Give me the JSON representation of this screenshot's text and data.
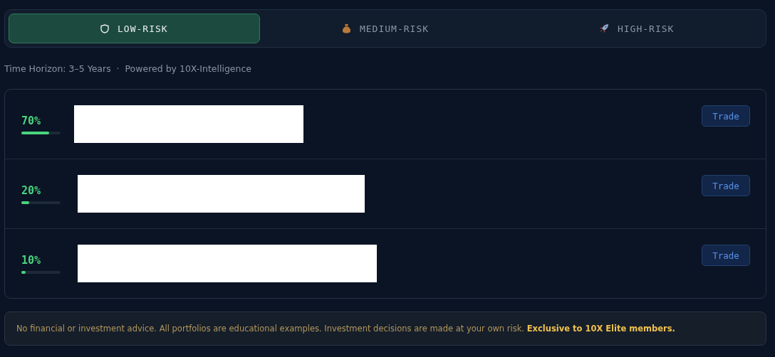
{
  "tabs": [
    {
      "label": "LOW-RISK",
      "kind": "shield",
      "selected": true
    },
    {
      "label": "MEDIUM-RISK",
      "kind": "bag",
      "selected": false
    },
    {
      "label": "HIGH-RISK",
      "kind": "rocket",
      "selected": false
    }
  ],
  "subtitle": "Time Horizon: 3–5 Years  ·  Powered by 10X-Intelligence",
  "allocations": [
    {
      "percent": "70%",
      "level": 0.7,
      "button": "Trade"
    },
    {
      "percent": "20%",
      "level": 0.2,
      "button": "Trade"
    },
    {
      "percent": "10%",
      "level": 0.1,
      "button": "Trade"
    }
  ],
  "disclaimer": "No financial or investment advice. All portfolios are educational examples. Investment decisions are made at your own risk. **Exclusive to 10X Elite members.**"
}
